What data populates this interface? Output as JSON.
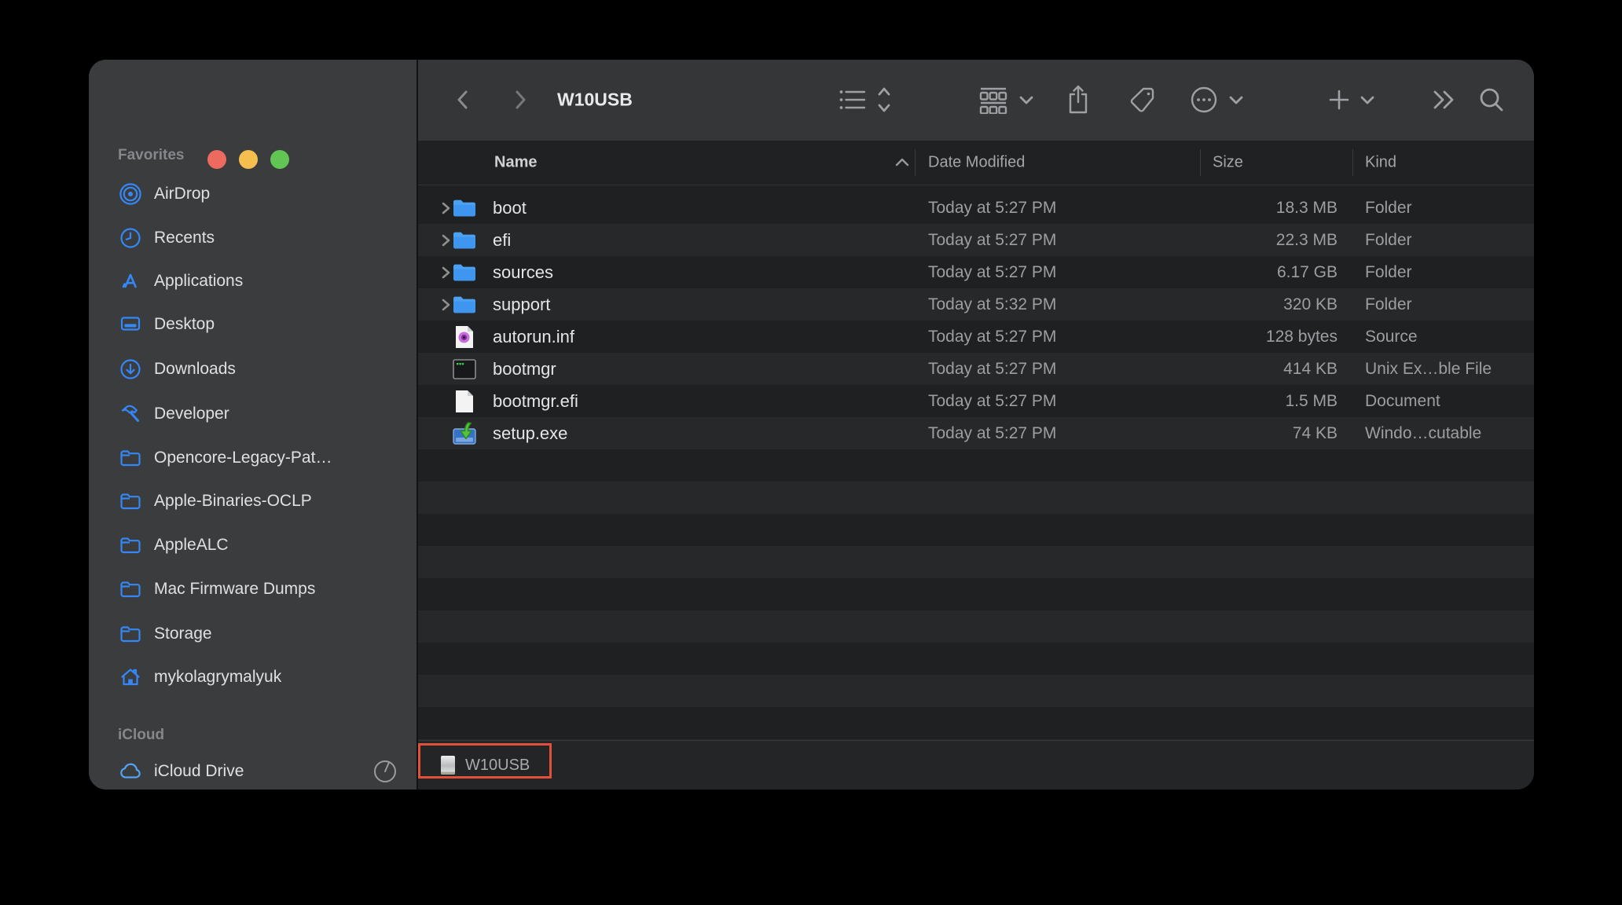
{
  "window": {
    "title": "W10USB",
    "traffic_lights": [
      "close",
      "minimize",
      "zoom"
    ]
  },
  "toolbar": {
    "title": "W10USB",
    "back_icon": "chevron-left",
    "forward_icon": "chevron-right",
    "controls": [
      "list-view",
      "group-by",
      "share",
      "tags",
      "more-actions",
      "new-item",
      "overflow",
      "search"
    ]
  },
  "sidebar": {
    "sections": [
      {
        "title": "Favorites",
        "items": [
          {
            "label": "AirDrop",
            "icon": "airdrop-icon"
          },
          {
            "label": "Recents",
            "icon": "clock-icon"
          },
          {
            "label": "Applications",
            "icon": "appstore-a-icon"
          },
          {
            "label": "Desktop",
            "icon": "desktop-icon"
          },
          {
            "label": "Downloads",
            "icon": "download-circle-icon"
          },
          {
            "label": "Developer",
            "icon": "hammer-icon"
          },
          {
            "label": "Opencore-Legacy-Pat…",
            "icon": "folder-icon"
          },
          {
            "label": "Apple-Binaries-OCLP",
            "icon": "folder-icon"
          },
          {
            "label": "AppleALC",
            "icon": "folder-icon"
          },
          {
            "label": "Mac Firmware Dumps",
            "icon": "folder-icon"
          },
          {
            "label": "Storage",
            "icon": "folder-icon"
          },
          {
            "label": "mykolagrymalyuk",
            "icon": "home-icon"
          }
        ]
      },
      {
        "title": "iCloud",
        "items": [
          {
            "label": "iCloud Drive",
            "icon": "cloud-icon",
            "trailing": "sync-progress-icon"
          }
        ]
      }
    ]
  },
  "list": {
    "columns": [
      {
        "label": "Name",
        "sort": "ascending"
      },
      {
        "label": "Date Modified"
      },
      {
        "label": "Size"
      },
      {
        "label": "Kind"
      }
    ],
    "files": [
      {
        "name": "boot",
        "date": "Today at 5:27 PM",
        "size": "18.3 MB",
        "kind": "Folder",
        "icon": "folder-icon",
        "expandable": true
      },
      {
        "name": "efi",
        "date": "Today at 5:27 PM",
        "size": "22.3 MB",
        "kind": "Folder",
        "icon": "folder-icon",
        "expandable": true
      },
      {
        "name": "sources",
        "date": "Today at 5:27 PM",
        "size": "6.17 GB",
        "kind": "Folder",
        "icon": "folder-icon",
        "expandable": true
      },
      {
        "name": "support",
        "date": "Today at 5:32 PM",
        "size": "320 KB",
        "kind": "Folder",
        "icon": "folder-icon",
        "expandable": true
      },
      {
        "name": "autorun.inf",
        "date": "Today at 5:27 PM",
        "size": "128 bytes",
        "kind": "Source",
        "icon": "source-file-icon",
        "expandable": false
      },
      {
        "name": "bootmgr",
        "date": "Today at 5:27 PM",
        "size": "414 KB",
        "kind": "Unix Ex…ble File",
        "icon": "unix-exec-icon",
        "expandable": false
      },
      {
        "name": "bootmgr.efi",
        "date": "Today at 5:27 PM",
        "size": "1.5 MB",
        "kind": "Document",
        "icon": "document-icon",
        "expandable": false
      },
      {
        "name": "setup.exe",
        "date": "Today at 5:27 PM",
        "size": "74 KB",
        "kind": "Windo…cutable",
        "icon": "windows-exec-icon",
        "expandable": false
      }
    ]
  },
  "statusbar": {
    "volume_label": "W10USB",
    "volume_icon": "external-disk-icon",
    "annotation": "red-highlight-box"
  },
  "colors": {
    "accent_blue": "#3687F6",
    "sidebar_bg": "#3A3C3E",
    "toolbar_bg": "#343638",
    "row_dark": "#1E2022",
    "row_light": "#26282A",
    "annotation_red": "#E1503B",
    "traffic_red": "#EC6A5E",
    "traffic_yellow": "#F5BF4F",
    "traffic_green": "#61C554"
  }
}
